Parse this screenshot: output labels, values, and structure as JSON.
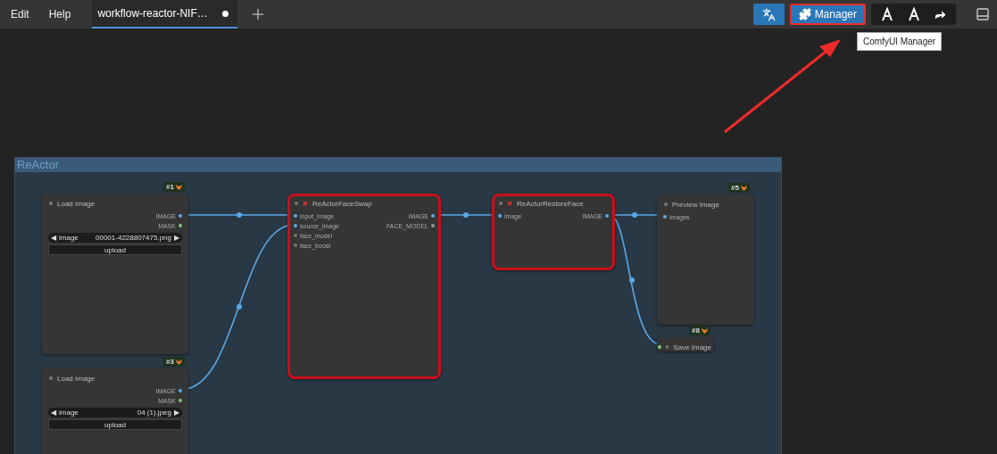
{
  "menu": [
    {
      "label": "Edit"
    },
    {
      "label": "Help"
    }
  ],
  "tabs": [
    {
      "label": "workflow-reactor-NIF…",
      "selected": true,
      "modified": true
    }
  ],
  "toolbar": {
    "manager_button": {
      "label": "Manager",
      "highlighted": true
    },
    "tooltip": "ComfyUI Manager"
  },
  "group": {
    "title": "ReActor"
  },
  "nodes": [
    {
      "kind": "full",
      "title": "Load Image",
      "badge": "#1",
      "highlighted": false,
      "error": false,
      "outputs": [
        {
          "label": "IMAGE",
          "color": "#5aa9e6"
        },
        {
          "label": "MASK",
          "color": "#7dc47d"
        }
      ],
      "widget": {
        "prev": "◀",
        "label": "image",
        "value": "00001-4228807475.png",
        "next": "▶"
      },
      "button": "upload"
    },
    {
      "kind": "full",
      "title": "Load Image",
      "badge": "#3",
      "highlighted": false,
      "error": false,
      "outputs": [
        {
          "label": "IMAGE",
          "color": "#5aa9e6"
        },
        {
          "label": "MASK",
          "color": "#7dc47d"
        }
      ],
      "widget": {
        "prev": "◀",
        "label": "image",
        "value": "04 (1).jpeg",
        "next": "▶"
      },
      "button": "upload"
    },
    {
      "kind": "full",
      "title": "ReActorFaceSwap",
      "highlighted": true,
      "error": true,
      "inputs": [
        {
          "label": "input_image",
          "color": "#5aa9e6"
        },
        {
          "label": "source_image",
          "color": "#5aa9e6"
        },
        {
          "label": "face_model",
          "color": "#777777"
        },
        {
          "label": "face_boost",
          "color": "#777777"
        }
      ],
      "outputs": [
        {
          "label": "IMAGE",
          "color": "#5aa9e6"
        },
        {
          "label": "FACE_MODEL",
          "color": "#999999"
        }
      ]
    },
    {
      "kind": "full",
      "title": "ReActorRestoreFace",
      "highlighted": true,
      "error": true,
      "inputs": [
        {
          "label": "image",
          "color": "#5aa9e6"
        }
      ],
      "outputs": [
        {
          "label": "IMAGE",
          "color": "#5aa9e6"
        }
      ]
    },
    {
      "kind": "full",
      "title": "Preview Image",
      "badge": "#5",
      "highlighted": false,
      "error": false,
      "inputs": [
        {
          "label": "images",
          "color": "#5aa9e6"
        }
      ]
    },
    {
      "kind": "collapsed",
      "title": "Save Image",
      "badge": "#8",
      "highlighted": false,
      "error": false
    }
  ]
}
